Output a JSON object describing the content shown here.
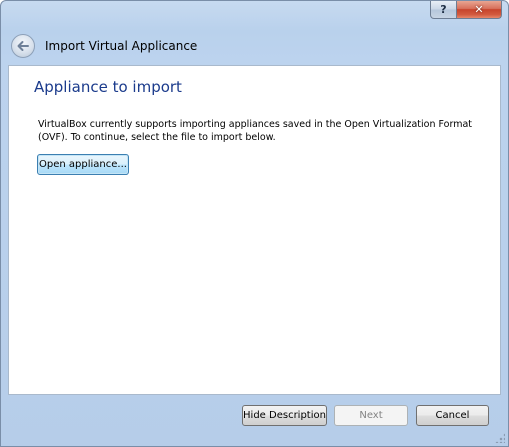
{
  "window": {
    "help_label": "?",
    "close_label": "✕"
  },
  "header": {
    "title": "Import Virtual Applicance"
  },
  "page": {
    "title": "Appliance to import",
    "description": "VirtualBox currently supports importing appliances saved in the Open Virtualization Format (OVF). To continue, select the file to import below.",
    "open_button_label": "Open appliance..."
  },
  "footer": {
    "hide_description_label": "Hide Description",
    "next_label": "Next",
    "cancel_label": "Cancel"
  },
  "icons": {
    "back": "back-arrow-icon",
    "close": "close-icon",
    "help": "help-icon",
    "grip": "resize-grip-icon"
  },
  "colors": {
    "title_blue": "#1b3b8c",
    "frame_blue": "#b9d1ec",
    "close_red": "#c7442c"
  }
}
